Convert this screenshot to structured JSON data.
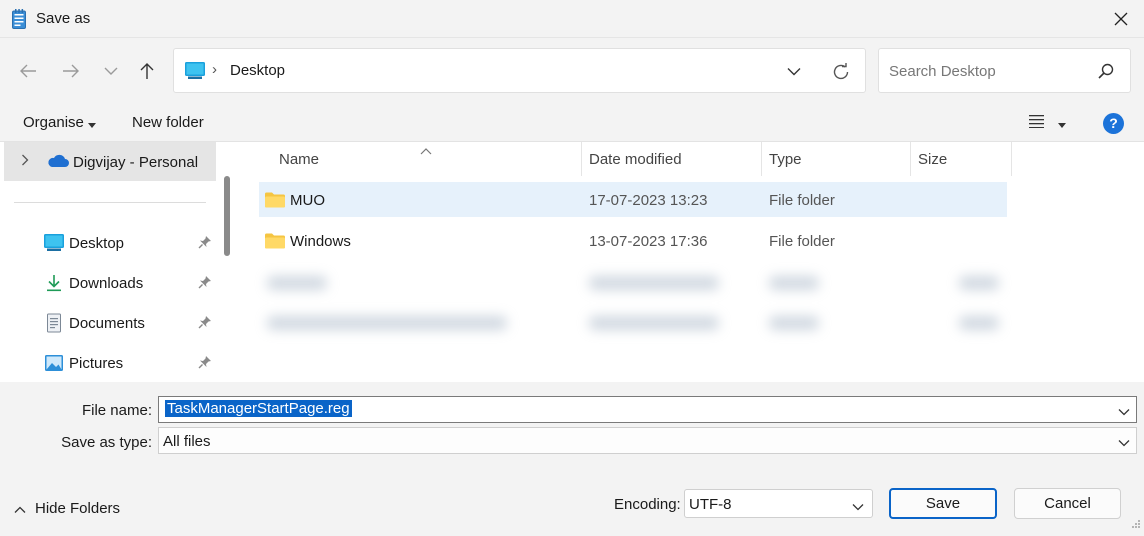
{
  "window": {
    "title": "Save as"
  },
  "address": {
    "location": "Desktop"
  },
  "search": {
    "placeholder": "Search Desktop"
  },
  "toolbar": {
    "organise_label": "Organise",
    "new_folder_label": "New folder",
    "help_label": "?"
  },
  "sidebar": {
    "onedrive_label": "Digvijay - Personal",
    "items": [
      {
        "label": "Desktop",
        "icon": "desktop-icon"
      },
      {
        "label": "Downloads",
        "icon": "downloads-icon"
      },
      {
        "label": "Documents",
        "icon": "documents-icon"
      },
      {
        "label": "Pictures",
        "icon": "pictures-icon"
      }
    ]
  },
  "filelist": {
    "columns": {
      "name": "Name",
      "date": "Date modified",
      "type": "Type",
      "size": "Size"
    },
    "rows": [
      {
        "name": "MUO",
        "date": "17-07-2023 13:23",
        "type": "File folder",
        "selected": true
      },
      {
        "name": "Windows",
        "date": "13-07-2023 17:36",
        "type": "File folder",
        "selected": false
      }
    ]
  },
  "form": {
    "file_name_label": "File name:",
    "file_name_value": "TaskManagerStartPage.reg",
    "save_type_label": "Save as type:",
    "save_type_value": "All files"
  },
  "footer": {
    "hide_folders_label": "Hide Folders",
    "encoding_label": "Encoding:",
    "encoding_value": "UTF-8",
    "save_label": "Save",
    "cancel_label": "Cancel"
  },
  "colors": {
    "accent": "#0a64c8",
    "selection": "#e6f1fb",
    "folder": "#f5c542"
  }
}
